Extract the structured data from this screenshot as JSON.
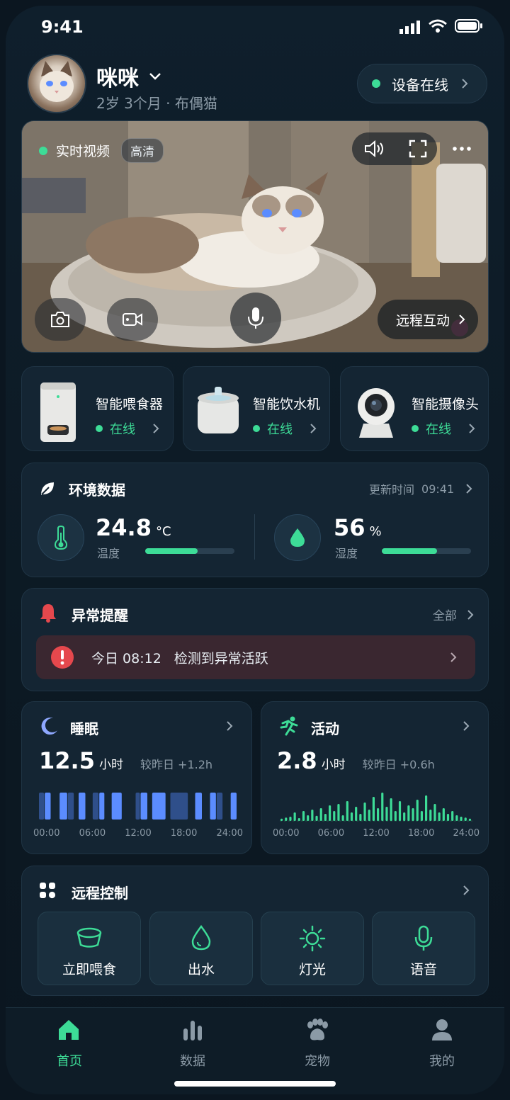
{
  "status_bar": {
    "time": "9:41",
    "icons": [
      "signal-icon",
      "wifi-icon",
      "battery-icon"
    ]
  },
  "pet": {
    "name": "咪咪",
    "info": "2岁 3个月 · 布偶猫"
  },
  "device_status": {
    "label": "设备在线"
  },
  "video": {
    "live_label": "实时视频",
    "quality": "高清",
    "interact_label": "远程互动",
    "icons": [
      "speaker-icon",
      "fullscreen-icon",
      "more-icon",
      "camera-icon",
      "video-record-icon",
      "microphone-icon"
    ]
  },
  "devices": [
    {
      "name": "智能喂食器",
      "status": "在线"
    },
    {
      "name": "智能饮水机",
      "status": "在线"
    },
    {
      "name": "智能摄像头",
      "status": "在线"
    }
  ],
  "environment": {
    "title": "环境数据",
    "update_label": "更新时间",
    "update_time": "09:41",
    "temperature": {
      "value": "24.8",
      "unit": "°C",
      "label": "温度",
      "level": 0.59
    },
    "humidity": {
      "value": "56",
      "unit": "%",
      "label": "湿度",
      "level": 0.62
    }
  },
  "alerts": {
    "title": "异常提醒",
    "all_label": "全部",
    "item": {
      "time": "今日 08:12",
      "text": "检测到异常活跃"
    }
  },
  "sleep": {
    "title": "睡眠",
    "value": "12.5",
    "unit": "小时",
    "compare": "较昨日 +1.2h",
    "ticks": [
      "00:00",
      "06:00",
      "12:00",
      "18:00",
      "24:00"
    ],
    "segments": [
      [
        0,
        0.7,
        "dark"
      ],
      [
        0.7,
        1.5,
        "light"
      ],
      [
        2.5,
        3.5,
        "light"
      ],
      [
        3.5,
        4.3,
        "dark"
      ],
      [
        4.8,
        5.7,
        "light"
      ],
      [
        6.5,
        7.3,
        "dark"
      ],
      [
        7.3,
        8,
        "light"
      ],
      [
        8.8,
        10.1,
        "light"
      ],
      [
        11.7,
        12.3,
        "dark"
      ],
      [
        12.3,
        13.2,
        "light"
      ],
      [
        13.7,
        15.4,
        "light"
      ],
      [
        15.9,
        18.1,
        "dark"
      ],
      [
        18.9,
        19.8,
        "light"
      ],
      [
        20.7,
        21.5,
        "light"
      ],
      [
        21.5,
        22.3,
        "dark"
      ],
      [
        23.2,
        24,
        "light"
      ]
    ]
  },
  "activity": {
    "title": "活动",
    "value": "2.8",
    "unit": "小时",
    "compare": "较昨日 +0.6h",
    "ticks": [
      "00:00",
      "06:00",
      "12:00",
      "18:00",
      "24:00"
    ],
    "bars": [
      0.08,
      0.12,
      0.15,
      0.3,
      0.1,
      0.35,
      0.2,
      0.4,
      0.18,
      0.45,
      0.25,
      0.55,
      0.35,
      0.6,
      0.2,
      0.7,
      0.3,
      0.5,
      0.25,
      0.65,
      0.4,
      0.85,
      0.45,
      1.0,
      0.5,
      0.8,
      0.35,
      0.7,
      0.3,
      0.55,
      0.45,
      0.75,
      0.35,
      0.9,
      0.4,
      0.6,
      0.3,
      0.45,
      0.25,
      0.35,
      0.2,
      0.15,
      0.12,
      0.08
    ]
  },
  "remote_control": {
    "title": "远程控制",
    "buttons": [
      {
        "label": "立即喂食",
        "icon": "food-bowl-icon"
      },
      {
        "label": "出水",
        "icon": "water-drop-icon"
      },
      {
        "label": "灯光",
        "icon": "light-icon"
      },
      {
        "label": "语音",
        "icon": "microphone-icon"
      }
    ]
  },
  "tabbar": [
    {
      "label": "首页",
      "icon": "home-icon",
      "active": true
    },
    {
      "label": "数据",
      "icon": "chart-icon",
      "active": false
    },
    {
      "label": "宠物",
      "icon": "paw-icon",
      "active": false
    },
    {
      "label": "我的",
      "icon": "profile-icon",
      "active": false
    }
  ],
  "colors": {
    "accent": "#3ddc97",
    "alert": "#e5484d",
    "sleep": "#5b8cff",
    "background": "#0f1f2c"
  }
}
